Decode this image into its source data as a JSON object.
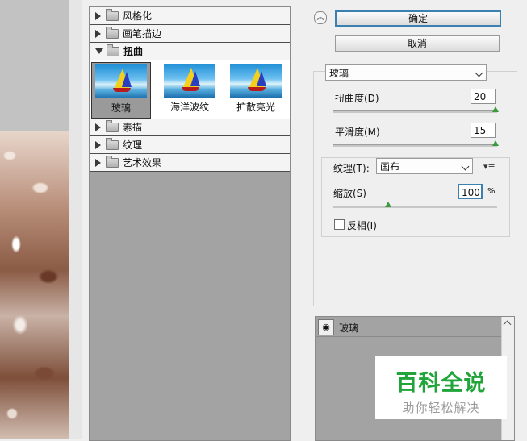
{
  "gallery": {
    "categories": [
      {
        "label": "风格化"
      },
      {
        "label": "画笔描边"
      },
      {
        "label": "扭曲"
      },
      {
        "label": "素描"
      },
      {
        "label": "纹理"
      },
      {
        "label": "艺术效果"
      }
    ],
    "thumbnails": [
      {
        "label": "玻璃",
        "selected": true
      },
      {
        "label": "海洋波纹"
      },
      {
        "label": "扩散亮光"
      }
    ]
  },
  "buttons": {
    "ok": "确定",
    "cancel": "取消"
  },
  "filter_select": "玻璃",
  "params": {
    "distortion": {
      "label": "扭曲度(D)",
      "value": "20",
      "slider_fraction": 1.0
    },
    "smoothness": {
      "label": "平滑度(M)",
      "value": "15",
      "slider_fraction": 1.0
    },
    "texture": {
      "label": "纹理(T):",
      "value": "画布"
    },
    "scaling": {
      "label": "缩放(S)",
      "value": "100",
      "unit": "%",
      "slider_fraction": 0.33
    },
    "invert": {
      "label": "反相(I)",
      "checked": false
    }
  },
  "layers": [
    {
      "name": "玻璃",
      "visible": true
    }
  ],
  "watermark": {
    "title": "百科全说",
    "subtitle": "助你轻松解决"
  },
  "colors": {
    "watermark_green": "#21a53a",
    "primary_border": "#3c7fb1",
    "slider_knob": "#3d9a3d"
  }
}
